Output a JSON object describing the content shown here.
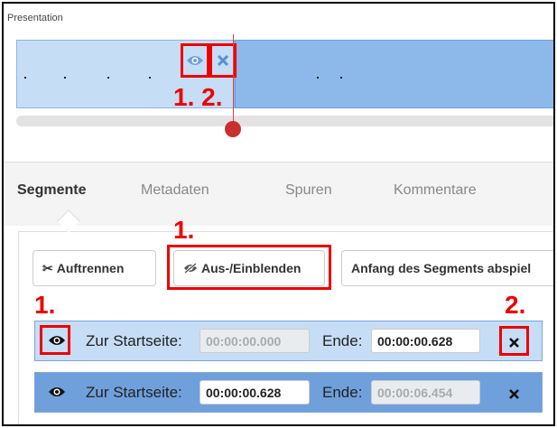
{
  "presentation": {
    "label": "Presentation"
  },
  "callouts": {
    "one": "1.",
    "two": "2.",
    "timeline": "1. 2."
  },
  "tabs": [
    {
      "label": "Segmente"
    },
    {
      "label": "Metadaten"
    },
    {
      "label": "Spuren"
    },
    {
      "label": "Kommentare"
    }
  ],
  "toolbar": {
    "split_label": "Auftrennen",
    "toggle_label": "Aus-/Einblenden",
    "play_start_label": "Anfang des Segments abspiel"
  },
  "segments": [
    {
      "title_label": "Zur Startseite:",
      "start": "00:00:00.000",
      "end_label": "Ende:",
      "end": "00:00:00.628"
    },
    {
      "title_label": "Zur Startseite:",
      "start": "00:00:00.628",
      "end_label": "Ende:",
      "end": "00:00:06.454"
    }
  ],
  "icons": {
    "eye": "eye-icon",
    "close": "close-icon",
    "scissors": "scissors-icon",
    "eye-slash": "eye-slash-icon"
  },
  "colors": {
    "accent_red": "#e00000",
    "segment_light": "#c6ddf6",
    "segment_dark": "#6fa0dc",
    "playhead": "#c9302c"
  }
}
